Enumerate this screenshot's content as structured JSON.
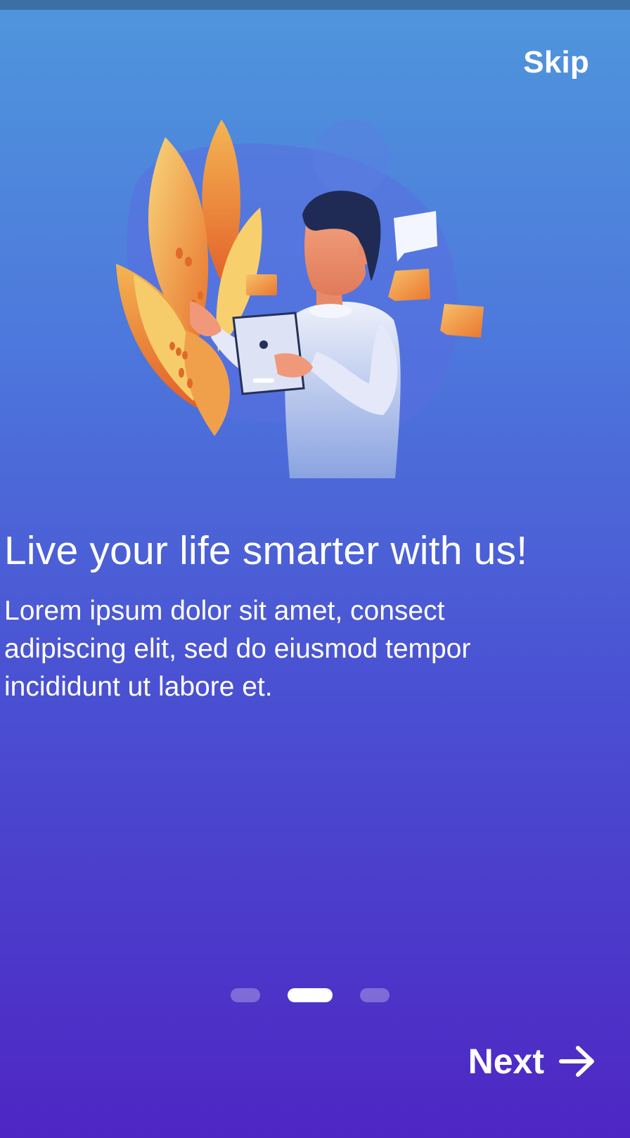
{
  "header": {
    "skip_label": "Skip"
  },
  "onboarding": {
    "title": "Live your life smarter with us!",
    "description": "Lorem ipsum dolor sit amet, consect adipiscing elit, sed do eiusmod tempor incididunt ut labore et.",
    "page_indicator": {
      "total_pages": 3,
      "current_page": 2
    }
  },
  "footer": {
    "next_label": "Next",
    "next_icon": "arrow-right-icon"
  },
  "colors": {
    "gradient_top": "#4f96dc",
    "gradient_bottom": "#4e26c3",
    "text": "#ffffff",
    "accent_orange": "#f0a04b"
  },
  "illustration": {
    "icon": "person-with-tablet-illustration"
  }
}
